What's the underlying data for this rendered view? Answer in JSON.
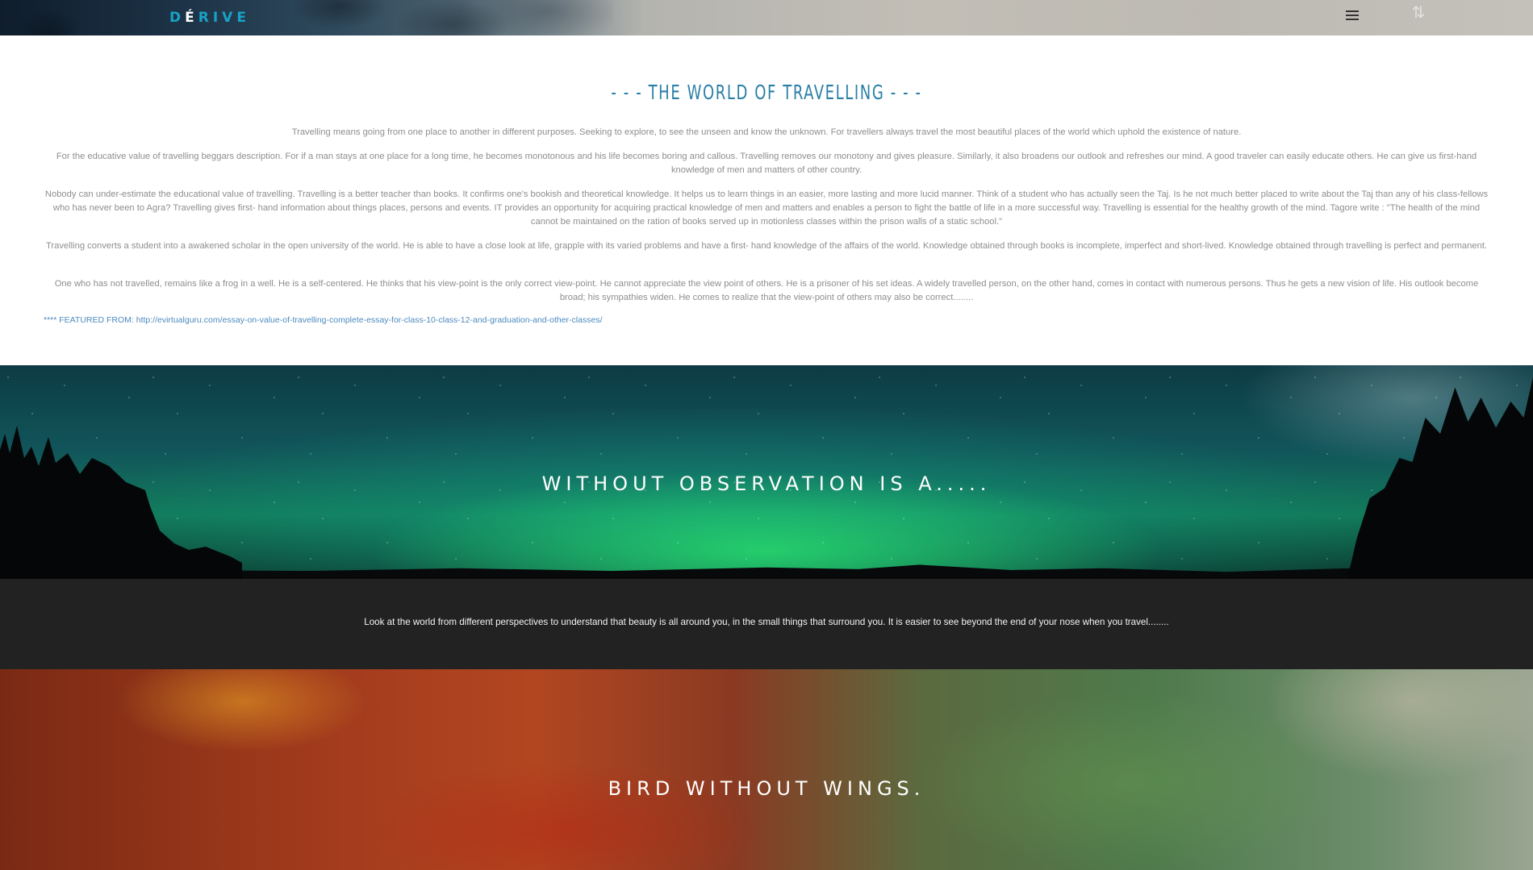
{
  "header": {
    "logo_text_part1": "D",
    "logo_text_accent": "É",
    "logo_text_part2": "RIVE",
    "menu_icon": "hamburger-menu-icon",
    "scroll_icon": "scroll-arrows-icon"
  },
  "article": {
    "title": "- - - THE WORLD OF TRAVELLING - - -",
    "paragraphs": [
      "Travelling means going from one place to another in different purposes. Seeking to explore, to see the unseen and know the unknown. For travellers always travel the most beautiful places of the world which uphold the existence of nature.",
      "For the educative value of travelling beggars description. For if a man stays at one place for a long time, he becomes monotonous and his life becomes boring and callous. Travelling removes our monotony and gives pleasure. Similarly, it also broadens our outlook and refreshes our mind. A good traveler can easily educate others. He can give us first-hand knowledge of men and matters of other country.",
      "Nobody can under-estimate the educational value of travelling. Travelling is a better teacher than books. It confirms one's bookish and theoretical knowledge. It helps us to learn things in an easier, more lasting and more lucid manner. Think of a student who has actually seen the Taj. Is he not much better placed to write about the Taj than any of his class-fellows who has never been to Agra? Travelling gives first- hand information about things places, persons and events. IT provides an opportunity for acquiring practical knowledge of men and matters and enables a person to fight the battle of life in a more successful way. Travelling is essential for the healthy growth of the mind. Tagore write : \"The health of the mind cannot be maintained on the ration of books served up in motionless classes within the prison walls of a static school.\"",
      "Travelling converts a student into a awakened scholar in the open university of the world. He is able to have a close look at life, grapple with its varied problems and have a first- hand knowledge of the affairs of the world. Knowledge obtained through books is incomplete, imperfect and short-lived. Knowledge obtained through travelling is perfect and permanent.",
      "One who has not travelled, remains like a frog in a well. He is a self-centered. He thinks that his view-point is the only correct view-point. He cannot appreciate the view point of others. He is a prisoner of his set ideas. A widely travelled person, on the other hand, comes in contact with numerous persons. Thus he gets a new vision of life. His outlook become broad; his sympathies widen. He comes to realize that the view-point of others may also be correct........"
    ],
    "source_prefix": "**** FEATURED FROM: ",
    "source_url": "http://evirtualguru.com/essay-on-value-of-travelling-complete-essay-for-class-10-class-12-and-graduation-and-other-classes/"
  },
  "hero_aurora": {
    "caption": "WITHOUT OBSERVATION IS A....."
  },
  "quote_band": {
    "text": "Look at the world from different perspectives to understand that beauty is all around you, in the small things that surround you. It is easier to see beyond the end of your nose when you travel........"
  },
  "hero_autumn": {
    "caption": "BIRD WITHOUT WINGS."
  },
  "colors": {
    "brand_accent": "#17a3c8",
    "title_blue": "#2a7fa6",
    "link_blue": "#4d8bbf",
    "body_text": "#8e8e8e",
    "dark_band": "#222222"
  }
}
